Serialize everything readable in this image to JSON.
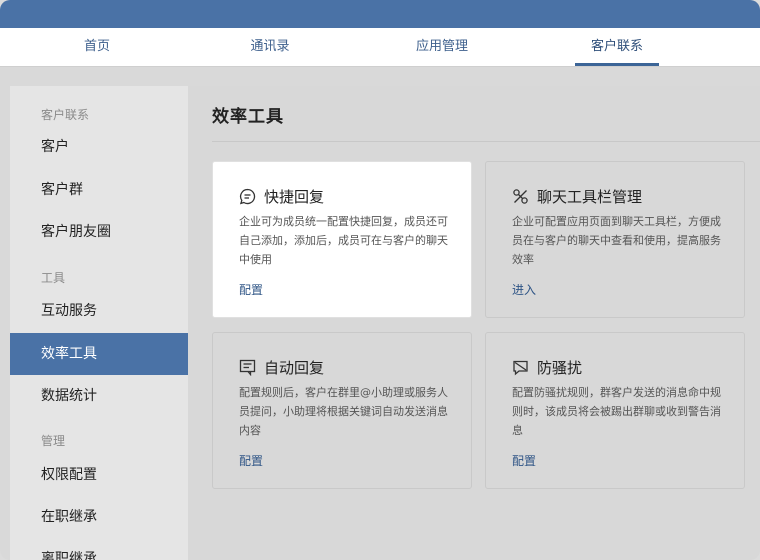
{
  "nav": {
    "tabs": [
      {
        "label": "首页"
      },
      {
        "label": "通讯录"
      },
      {
        "label": "应用管理"
      },
      {
        "label": "客户联系"
      }
    ],
    "active_tab": "客户联系"
  },
  "sidebar": {
    "groups": [
      "客户联系",
      "工具",
      "管理"
    ],
    "items": [
      {
        "label": "客户"
      },
      {
        "label": "客户群"
      },
      {
        "label": "客户朋友圈"
      },
      {
        "label": "互动服务"
      },
      {
        "label": "效率工具"
      },
      {
        "label": "数据统计"
      },
      {
        "label": "权限配置"
      },
      {
        "label": "在职继承"
      },
      {
        "label": "离职继承"
      }
    ],
    "active_item": "效率工具"
  },
  "main": {
    "title": "效率工具",
    "cards": [
      {
        "icon": "chat-bubble-icon",
        "title": "快捷回复",
        "desc": "企业可为成员统一配置快捷回复，成员还可自己添加，添加后，成员可在与客户的聊天中使用",
        "action": "配置"
      },
      {
        "icon": "tools-icon",
        "title": "聊天工具栏管理",
        "desc": "企业可配置应用页面到聊天工具栏，方便成员在与客户的聊天中查看和使用，提高服务效率",
        "action": "进入"
      },
      {
        "icon": "auto-reply-icon",
        "title": "自动回复",
        "desc": "配置规则后，客户在群里@小助理或服务人员提问，小助理将根据关键词自动发送消息内容",
        "action": "配置"
      },
      {
        "icon": "anti-harassment-icon",
        "title": "防骚扰",
        "desc": "配置防骚扰规则，群客户发送的消息命中规则时，该成员将会被踢出群聊或收到警告消息",
        "action": "配置"
      }
    ]
  },
  "colors": {
    "titlebar": "#4a72a6",
    "accent": "#3c6597",
    "link": "#2f5586"
  }
}
